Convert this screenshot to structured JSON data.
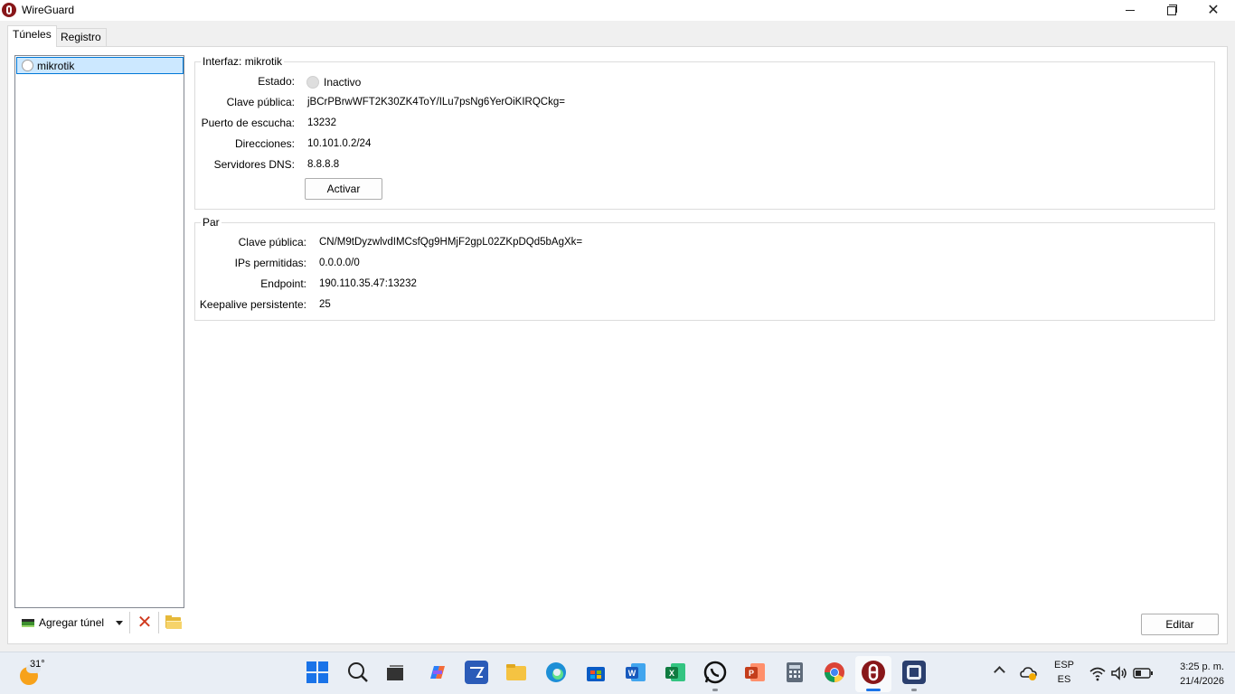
{
  "window": {
    "title": "WireGuard"
  },
  "tabs": [
    {
      "label": "Túneles",
      "active": true
    },
    {
      "label": "Registro",
      "active": false
    }
  ],
  "tunnels": [
    {
      "name": "mikrotik",
      "selected": true
    }
  ],
  "toolbar": {
    "add_tunnel_label": "Agregar túnel"
  },
  "interface": {
    "title": "Interfaz: mikrotik",
    "fields": {
      "status_label": "Estado:",
      "status_value": "Inactivo",
      "public_key_label": "Clave pública:",
      "public_key_value": "jBCrPBrwWFT2K30ZK4ToY/ILu7psNg6YerOiKIRQCkg=",
      "listen_port_label": "Puerto de escucha:",
      "listen_port_value": "13232",
      "addresses_label": "Direcciones:",
      "addresses_value": "10.101.0.2/24",
      "dns_label": "Servidores DNS:",
      "dns_value": "8.8.8.8"
    },
    "activate_label": "Activar"
  },
  "peer": {
    "title": "Par",
    "fields": {
      "public_key_label": "Clave pública:",
      "public_key_value": "CN/M9tDyzwlvdIMCsfQg9HMjF2gpL02ZKpDQd5bAgXk=",
      "allowed_ips_label": "IPs permitidas:",
      "allowed_ips_value": "0.0.0.0/0",
      "endpoint_label": "Endpoint:",
      "endpoint_value": "190.110.35.47:13232",
      "keepalive_label": "Keepalive persistente:",
      "keepalive_value": "25"
    }
  },
  "edit_label": "Editar",
  "taskbar": {
    "temperature": "31°",
    "apps": [
      "start-icon",
      "search-icon",
      "task-view-icon",
      "copilot-icon",
      "store-app-icon",
      "file-explorer-icon",
      "edge-icon",
      "microsoft-store-icon",
      "word-icon",
      "excel-icon",
      "whatsapp-icon",
      "powerpoint-icon",
      "calculator-icon",
      "chrome-icon",
      "wireguard-icon",
      "winbox-icon"
    ],
    "language_top": "ESP",
    "language_bottom": "ES",
    "time": "3:25 p. m.",
    "date": "21/4/2026"
  },
  "colors": {
    "selection": "#cce8ff",
    "selection_border": "#0078d7",
    "wireguard_red": "#88171a",
    "delete_red": "#d03a1f"
  }
}
